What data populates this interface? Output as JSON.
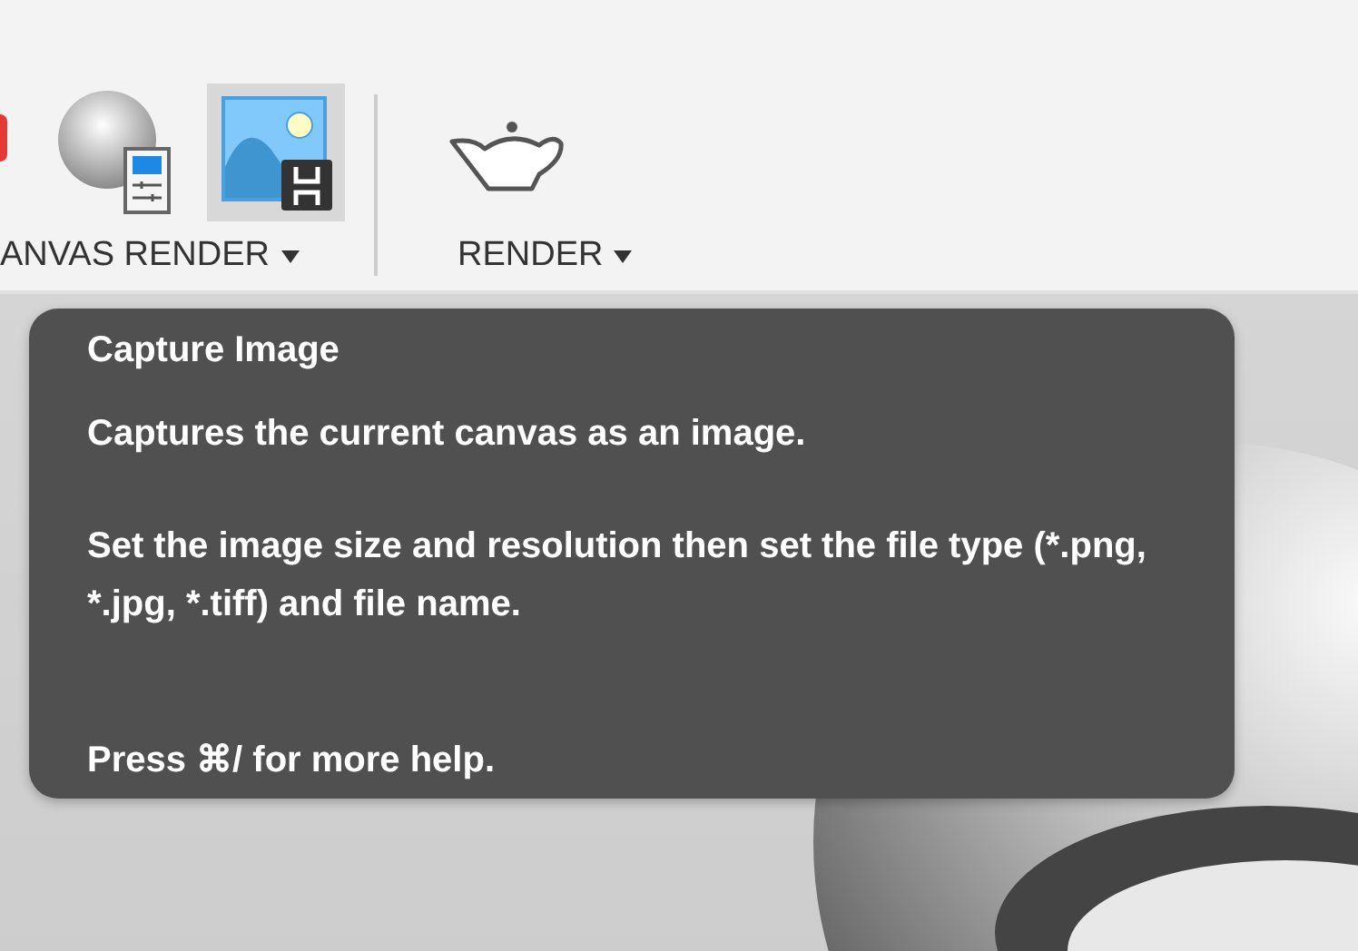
{
  "toolbar": {
    "groups": [
      {
        "kind": "canvas-render",
        "label": "ANVAS RENDER",
        "tools": [
          {
            "kind": "partial"
          },
          {
            "kind": "sphere",
            "selected": false
          },
          {
            "kind": "capture",
            "selected": true
          }
        ]
      },
      {
        "kind": "render",
        "label": "RENDER",
        "tools": [
          {
            "kind": "teapot",
            "selected": false
          }
        ]
      }
    ]
  },
  "tooltip": {
    "title": "Capture Image",
    "paragraphs": [
      "Captures the current canvas as an image.",
      "Set the image size and resolution then set the file type (*.png, *.jpg, *.tiff) and file name.",
      "Press ⌘/ for more help."
    ]
  }
}
